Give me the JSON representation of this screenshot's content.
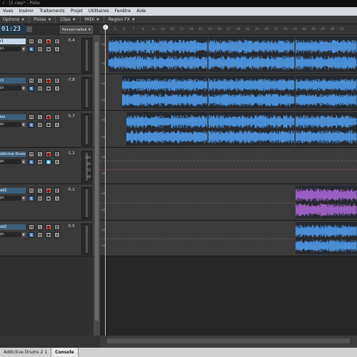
{
  "window": {
    "title": "r - [2.cwp* - Piste"
  },
  "menu": [
    "Vues",
    "Insérer",
    "Traitements",
    "Projet",
    "Utilitaires",
    "Fenêtre",
    "Aide"
  ],
  "toolbar": {
    "items": [
      "Options",
      "Pistes",
      "Clips",
      "MIDI",
      "Region FX"
    ]
  },
  "transport": {
    "time": "01:23",
    "layout": "Personnalisé"
  },
  "ruler": {
    "ticks": [
      "1",
      "3",
      "5",
      "7",
      "9",
      "11",
      "13",
      "15",
      "17",
      "19",
      "21",
      "23",
      "25",
      "27",
      "29",
      "31",
      "33",
      "35",
      "37",
      "39",
      "41",
      "43",
      "45",
      "47",
      "49",
      "51"
    ]
  },
  "tracks": [
    {
      "name": "r1",
      "input": "ps",
      "volume": "-5,4",
      "selected": true
    },
    {
      "name": "r2",
      "input": "ps",
      "volume": "-7,8",
      "selected": false
    },
    {
      "name": "ies",
      "input": "ps",
      "volume": "-5,7",
      "selected": false
    },
    {
      "name": "ddictive Drums",
      "input": "ps",
      "volume": "-1,2",
      "selected": false,
      "meter_labels": [
        "120",
        "96",
        "72",
        "48"
      ]
    },
    {
      "name": "ad1",
      "input": "ps",
      "volume": "-5,1",
      "selected": false
    },
    {
      "name": "ad2",
      "input": "ps",
      "volume": "-5,5",
      "selected": false
    }
  ],
  "track_buttons": {
    "mute": "M",
    "solo": "S",
    "record": "●",
    "echo": "E",
    "read": "R",
    "write": "W",
    "fx": "✱",
    "arm": "A"
  },
  "clips": {
    "blue": "#4a8fd6",
    "purple": "#9a5fc0"
  },
  "bottom_tabs": [
    "Addictive Drums 2 1",
    "Console"
  ]
}
